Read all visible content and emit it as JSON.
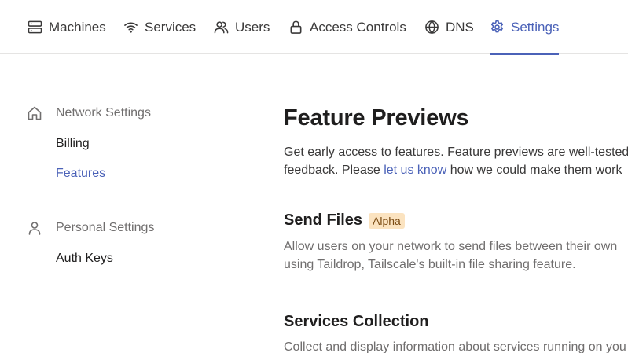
{
  "nav": {
    "items": [
      {
        "label": "Machines",
        "icon": "server-icon"
      },
      {
        "label": "Services",
        "icon": "wifi-icon"
      },
      {
        "label": "Users",
        "icon": "users-icon"
      },
      {
        "label": "Access Controls",
        "icon": "lock-icon"
      },
      {
        "label": "DNS",
        "icon": "globe-icon"
      },
      {
        "label": "Settings",
        "icon": "gear-icon",
        "active": true
      }
    ],
    "accent_color": "#4b62b8"
  },
  "sidebar": {
    "network": {
      "heading": "Network Settings",
      "icon": "home-icon",
      "links": [
        "Billing",
        "Features"
      ]
    },
    "personal": {
      "heading": "Personal Settings",
      "icon": "user-icon",
      "links": [
        "Auth Keys"
      ]
    },
    "active_link": "Features"
  },
  "main": {
    "title": "Feature Previews",
    "intro": {
      "line1": "Get early access to features. Feature previews are well-tested",
      "line2_before": "feedback. Please ",
      "link": "let us know",
      "line2_after": " how we could make them work"
    },
    "features": [
      {
        "title": "Send Files",
        "badge": "Alpha",
        "line1": "Allow users on your network to send files between their own",
        "line2": "using Taildrop, Tailscale's built-in file sharing feature."
      },
      {
        "title": "Services Collection",
        "line1": "Collect and display information about services running on you"
      }
    ],
    "badge_color": "#fbe3c0"
  }
}
